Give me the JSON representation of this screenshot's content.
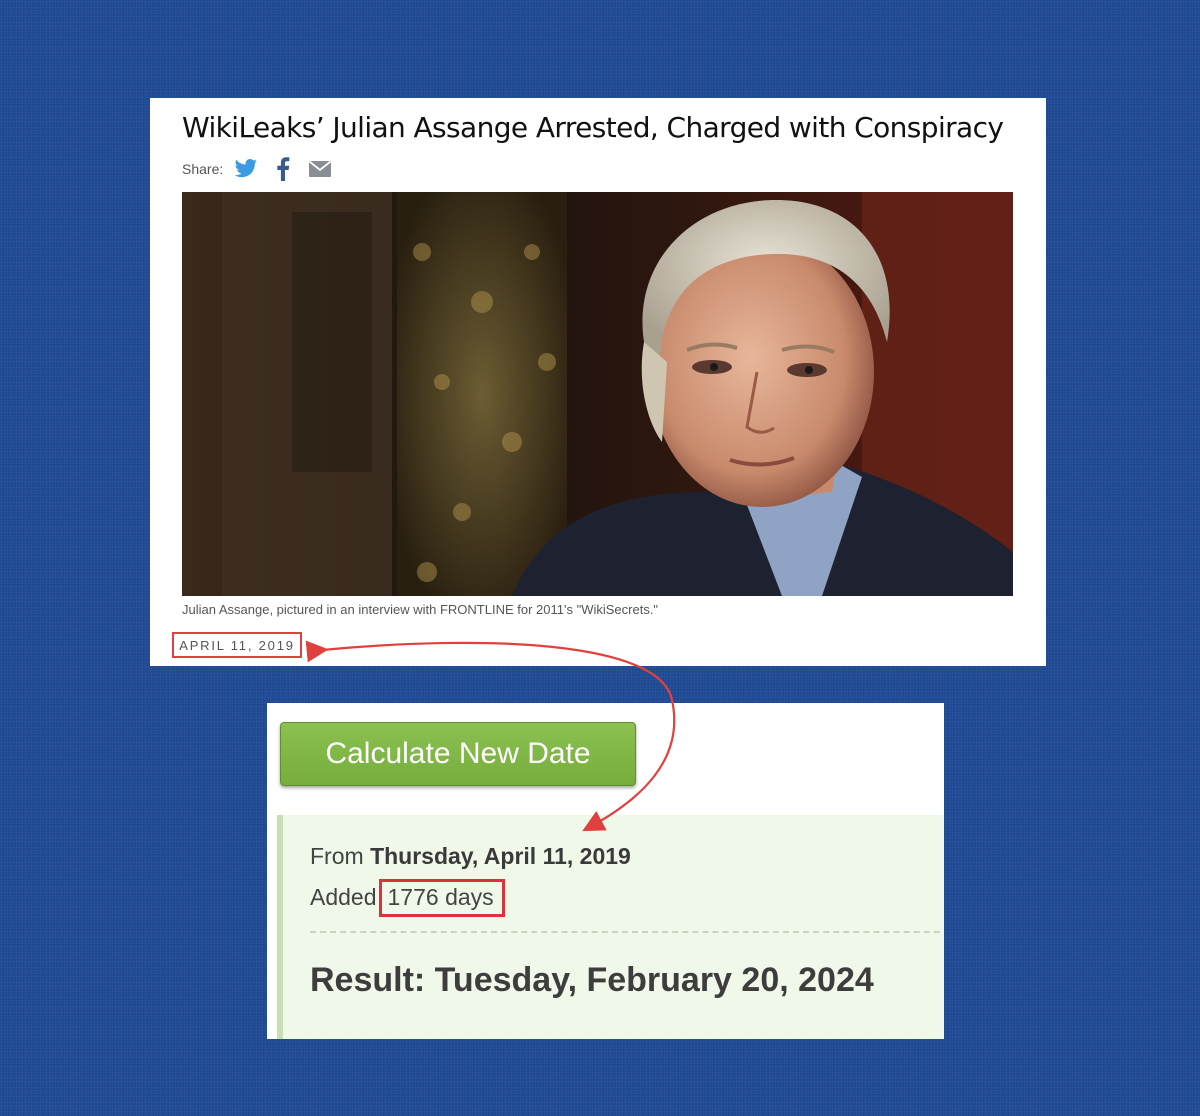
{
  "article": {
    "headline": "WikiLeaks’ Julian Assange Arrested, Charged with Conspiracy",
    "share_label": "Share:",
    "share_icons": [
      "twitter-icon",
      "facebook-icon",
      "email-icon"
    ],
    "photo_caption": "Julian Assange, pictured in an interview with FRONTLINE for 2011's \"WikiSecrets.\"",
    "date": "APRIL 11, 2019"
  },
  "calculator": {
    "button_label": "Calculate New Date",
    "from_prefix": "From",
    "from_date": "Thursday, April 11, 2019",
    "added_prefix": "Added",
    "added_value": "1776 days",
    "result": "Result: Tuesday, February 20, 2024"
  },
  "colors": {
    "background": "#1f4a94",
    "highlight": "#e0413f",
    "button_green": "#7cb342",
    "result_panel": "#eff8e9"
  }
}
